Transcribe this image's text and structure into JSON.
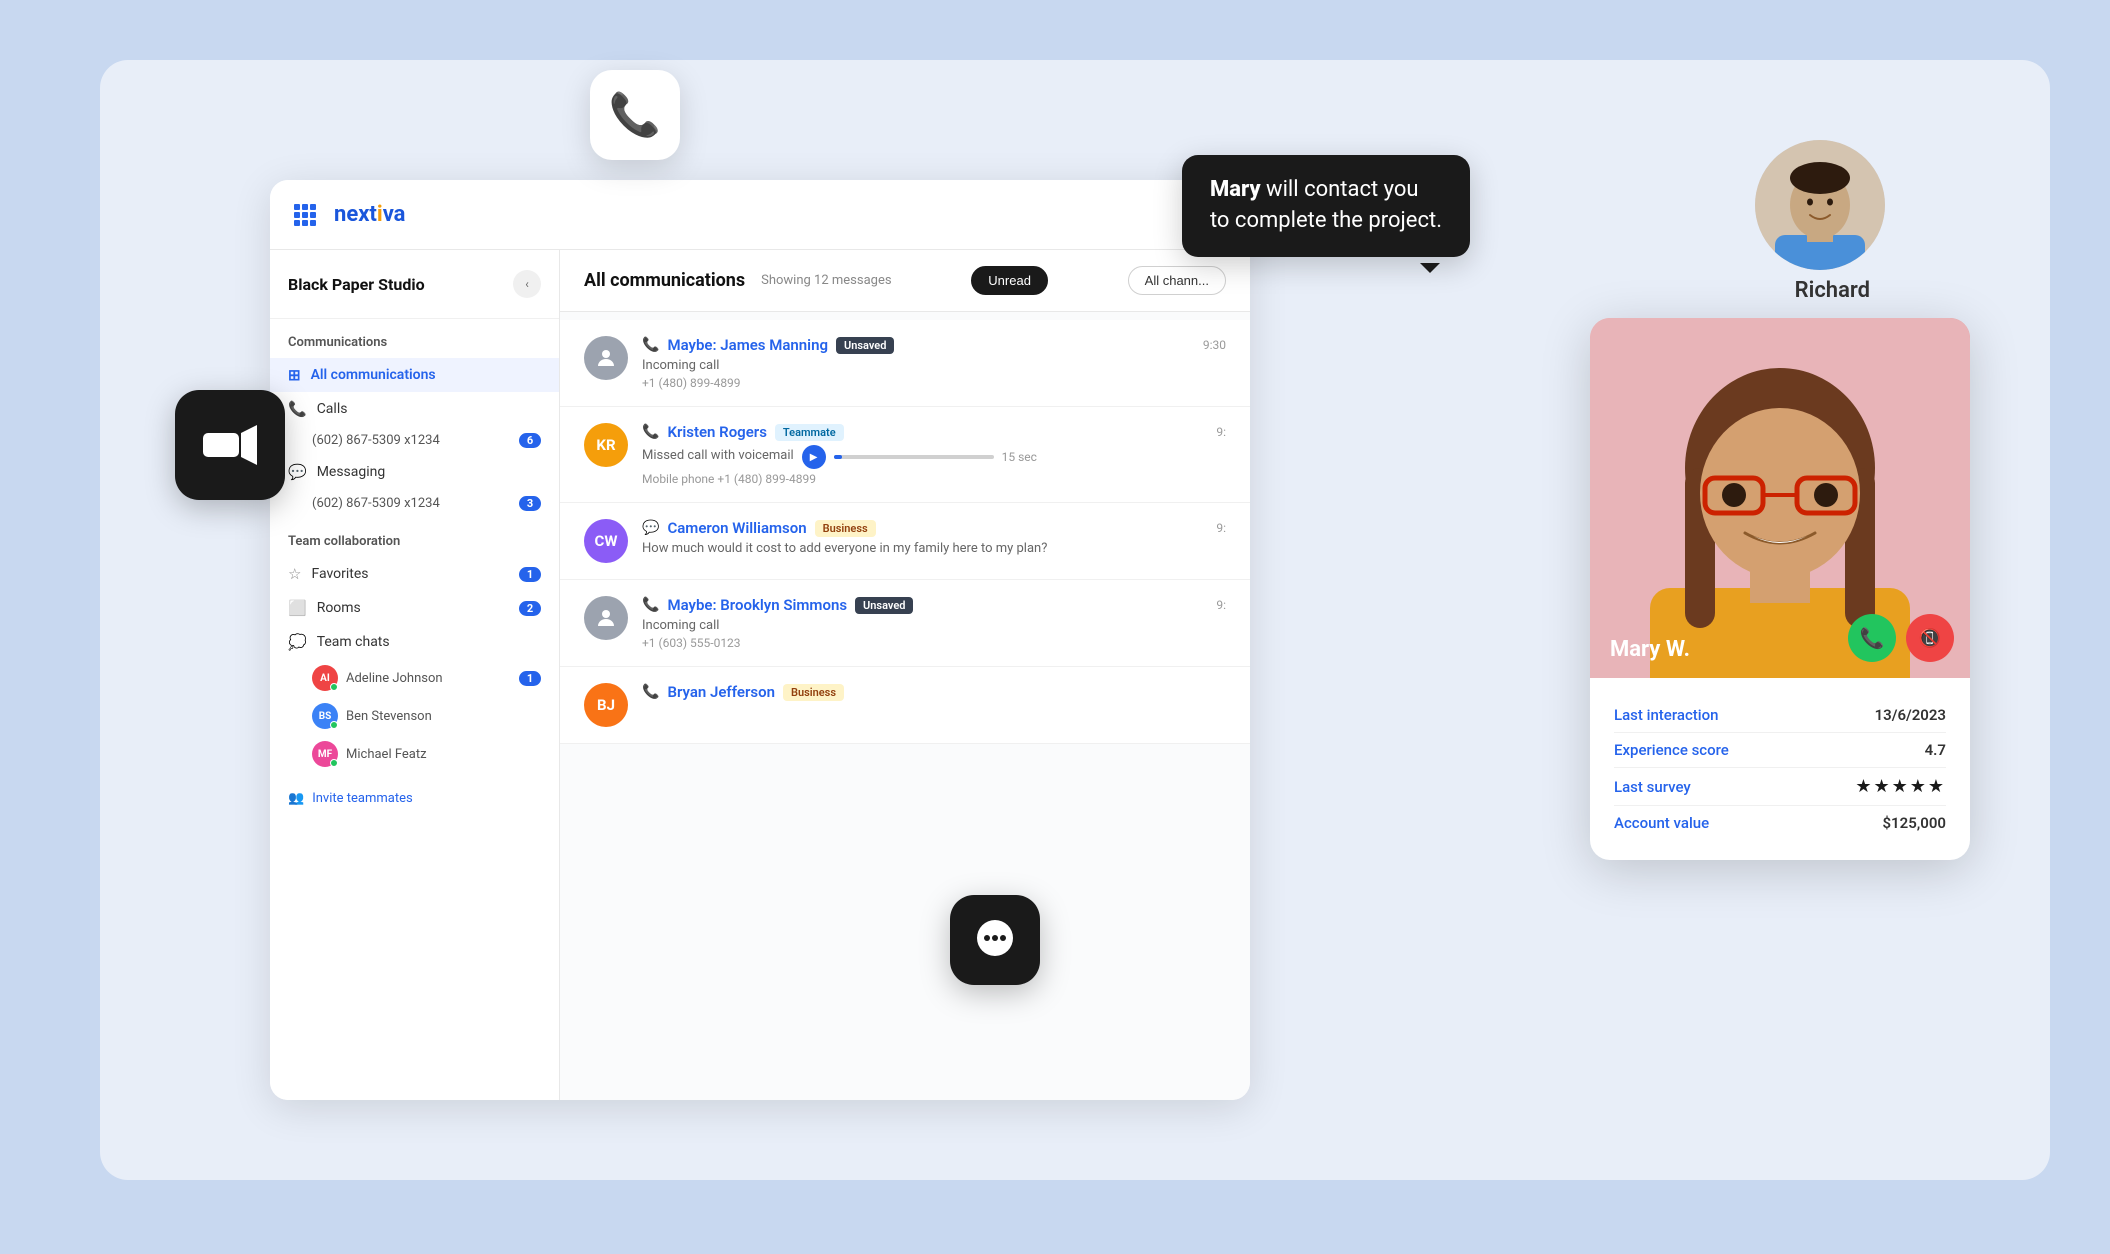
{
  "app": {
    "logo": "nextiva",
    "workspace": "Black Paper Studio"
  },
  "header": {
    "title": "All communications",
    "subtitle": "Showing 12 messages",
    "filter_unread": "Unread",
    "filter_channels": "All chann..."
  },
  "sidebar": {
    "communications_label": "Communications",
    "all_communications": "All communications",
    "calls_label": "Calls",
    "calls_number": "(602) 867-5309 x1234",
    "calls_badge": "6",
    "messaging_label": "Messaging",
    "messaging_number": "(602) 867-5309 x1234",
    "messaging_badge": "3",
    "team_collab_label": "Team collaboration",
    "favorites_label": "Favorites",
    "favorites_badge": "1",
    "rooms_label": "Rooms",
    "rooms_badge": "2",
    "team_chats_label": "Team chats",
    "chat1_name": "Adeline Johnson",
    "chat1_badge": "1",
    "chat2_name": "Ben Stevenson",
    "chat3_name": "Michael Featz",
    "invite_label": "Invite teammates"
  },
  "messages": [
    {
      "id": 1,
      "name": "Maybe: James Manning",
      "tag": "Unsaved",
      "tag_class": "tag-unsaved",
      "body": "Incoming call",
      "sub": "+1 (480) 899-4899",
      "time": "9:30",
      "type": "call",
      "avatar_letters": "",
      "avatar_color": "#9ca3af"
    },
    {
      "id": 2,
      "name": "Kristen Rogers",
      "tag": "Teammate",
      "tag_class": "tag-teammate",
      "body": "Missed call with voicemail",
      "sub": "Mobile phone +1 (480) 899-4899",
      "time": "9:",
      "type": "voicemail",
      "avatar_letters": "KR",
      "avatar_color": "#f59e0b"
    },
    {
      "id": 3,
      "name": "Cameron Williamson",
      "tag": "Business",
      "tag_class": "tag-business",
      "body": "How much would it cost to add everyone in my family here to my plan?",
      "sub": "",
      "time": "9:",
      "type": "message",
      "avatar_letters": "CW",
      "avatar_color": "#8b5cf6"
    },
    {
      "id": 4,
      "name": "Maybe: Brooklyn Simmons",
      "tag": "Unsaved",
      "tag_class": "tag-unsaved",
      "body": "Incoming call",
      "sub": "+1 (603) 555-0123",
      "time": "9:",
      "type": "call",
      "avatar_letters": "",
      "avatar_color": "#9ca3af"
    },
    {
      "id": 5,
      "name": "Bryan Jefferson",
      "tag": "Business",
      "tag_class": "tag-business",
      "body": "",
      "sub": "",
      "time": "",
      "type": "message",
      "avatar_letters": "BJ",
      "avatar_color": "#f97316"
    }
  ],
  "tooltip": {
    "name": "Mary",
    "text": " will contact you\nto complete the project."
  },
  "richard": {
    "name": "Richard"
  },
  "call_card": {
    "caller_name": "Mary W.",
    "last_interaction_label": "Last interaction",
    "last_interaction_value": "13/6/2023",
    "experience_score_label": "Experience score",
    "experience_score_value": "4.7",
    "last_survey_label": "Last survey",
    "last_survey_stars": "★★★★★",
    "account_value_label": "Account value",
    "account_value": "$125,000"
  },
  "floating": {
    "phone_icon": "📞",
    "video_icon": "📹",
    "chat_icon": "💬"
  }
}
